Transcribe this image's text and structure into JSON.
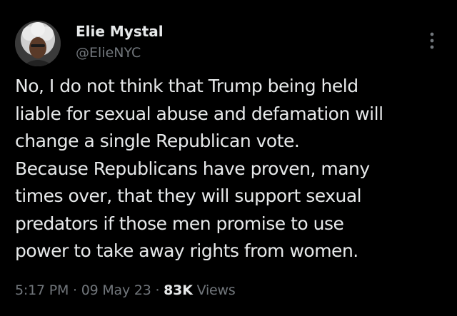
{
  "tweet": {
    "author": {
      "display_name": "Elie Mystal",
      "handle": "@ElieNYC",
      "avatar_icon": "user-avatar"
    },
    "more_icon": "more-options-icon",
    "text_lines": [
      "No, I do not think that Trump being held",
      "liable for sexual abuse and defamation will",
      "change a single Republican vote.",
      "Because Republicans have proven, many",
      "times over, that they will support sexual",
      "predators if those men promise to use",
      "power to take away rights from women."
    ],
    "meta": {
      "time": "5:17 PM",
      "separator": "·",
      "date": "09 May 23",
      "views_count": "83K",
      "views_label": "Views"
    }
  },
  "colors": {
    "background": "#000000",
    "primary_text": "#e7e9ea",
    "secondary_text": "#71767b"
  }
}
